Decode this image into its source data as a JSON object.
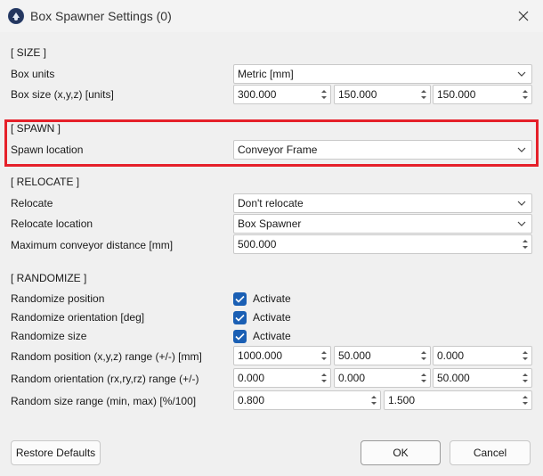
{
  "window": {
    "title": "Box Spawner Settings (0)"
  },
  "size": {
    "section_title": "[ SIZE ]",
    "box_units_label": "Box units",
    "box_units_value": "Metric [mm]",
    "box_size_label": "Box size (x,y,z) [units]",
    "box_size_x": "300.000",
    "box_size_y": "150.000",
    "box_size_z": "150.000"
  },
  "spawn": {
    "section_title": "[ SPAWN ]",
    "spawn_location_label": "Spawn location",
    "spawn_location_value": "Conveyor Frame"
  },
  "relocate": {
    "section_title": "[ RELOCATE ]",
    "relocate_label": "Relocate",
    "relocate_value": "Don't relocate",
    "relocate_location_label": "Relocate location",
    "relocate_location_value": "Box Spawner",
    "max_distance_label": "Maximum conveyor distance [mm]",
    "max_distance_value": "500.000"
  },
  "randomize": {
    "section_title": "[ RANDOMIZE ]",
    "position_label": "Randomize position",
    "orientation_label": "Randomize orientation [deg]",
    "size_label": "Randomize size",
    "activate_label": "Activate",
    "position_checked": true,
    "orientation_checked": true,
    "size_checked": true,
    "pos_range_label": "Random position (x,y,z) range (+/-) [mm]",
    "pos_range_x": "1000.000",
    "pos_range_y": "50.000",
    "pos_range_z": "0.000",
    "orient_range_label": "Random orientation (rx,ry,rz) range (+/-)",
    "orient_range_rx": "0.000",
    "orient_range_ry": "0.000",
    "orient_range_rz": "50.000",
    "size_range_label": "Random size range (min, max) [%/100]",
    "size_range_min": "0.800",
    "size_range_max": "1.500"
  },
  "buttons": {
    "restore_defaults": "Restore Defaults",
    "ok": "OK",
    "cancel": "Cancel"
  },
  "colors": {
    "highlight": "#e5202a",
    "checkbox": "#1a5fb4"
  }
}
